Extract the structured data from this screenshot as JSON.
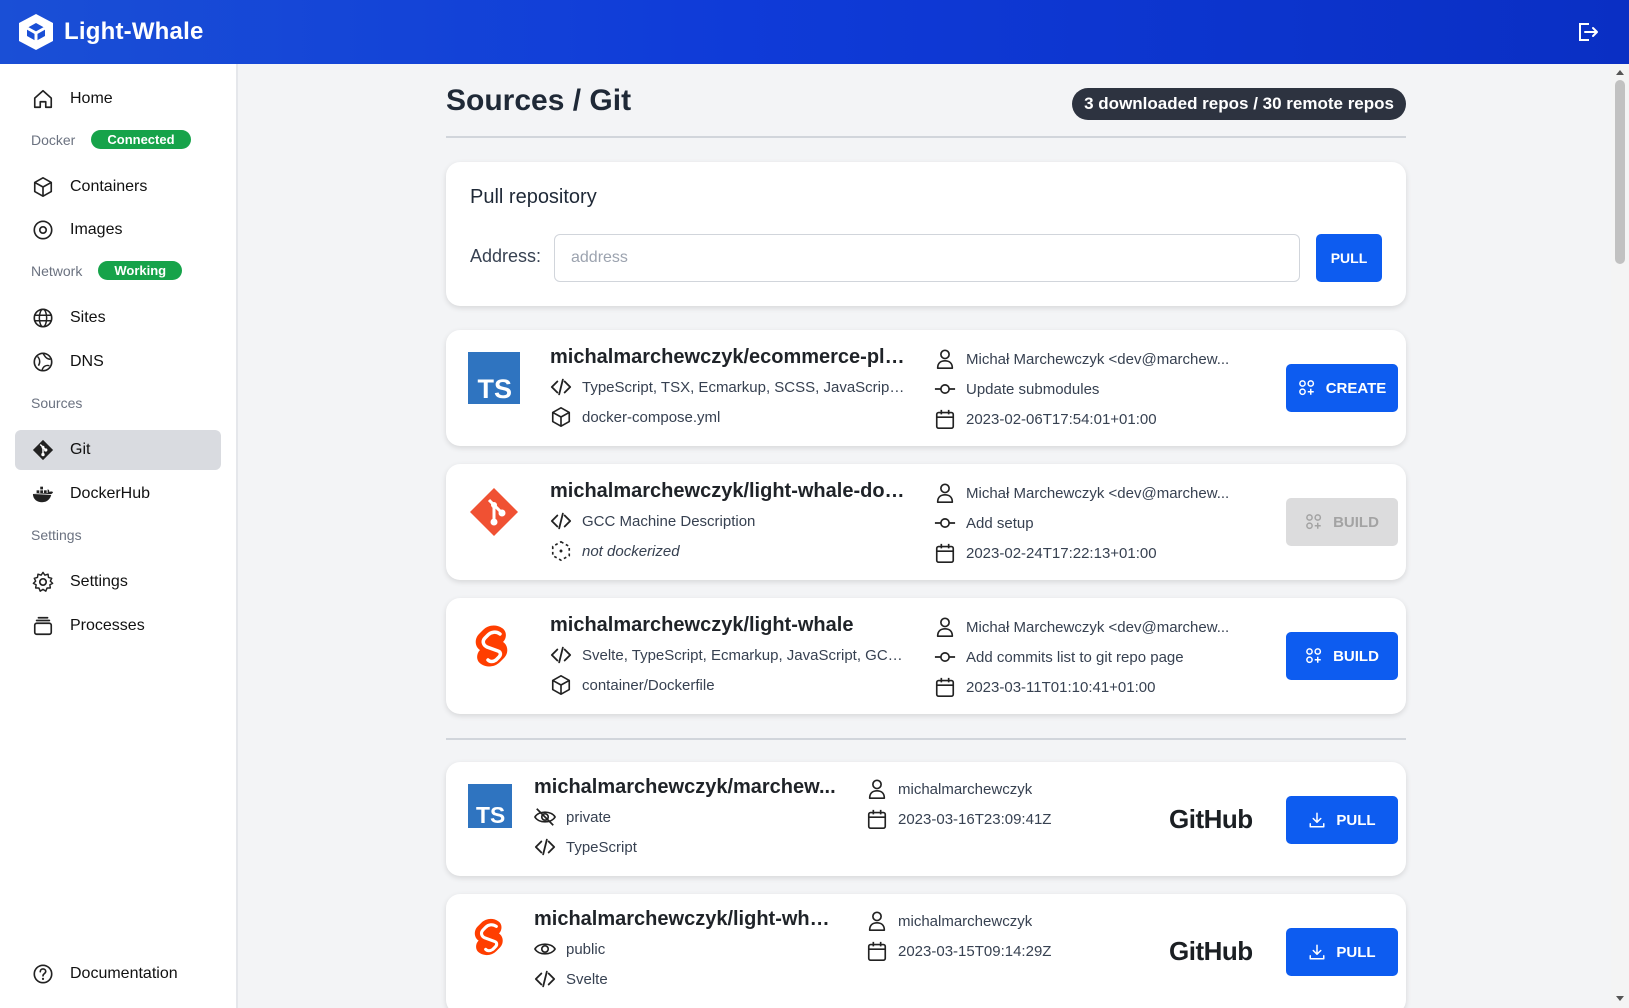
{
  "app": {
    "name": "Light-Whale"
  },
  "sidebar": {
    "home": "Home",
    "docker_label": "Docker",
    "docker_status": "Connected",
    "containers": "Containers",
    "images": "Images",
    "network_label": "Network",
    "network_status": "Working",
    "sites": "Sites",
    "dns": "DNS",
    "sources_label": "Sources",
    "git": "Git",
    "dockerhub": "DockerHub",
    "settings_label": "Settings",
    "settings": "Settings",
    "processes": "Processes",
    "documentation": "Documentation"
  },
  "page": {
    "title": "Sources / Git",
    "counter": "3 downloaded repos / 30 remote repos"
  },
  "pull": {
    "title": "Pull repository",
    "address_label": "Address:",
    "address_placeholder": "address",
    "address_value": "",
    "button": "PULL"
  },
  "local_repos": [
    {
      "language_icon": "typescript-logo",
      "name": "michalmarchewczyk/ecommerce-pla...",
      "languages": "TypeScript, TSX, Ecmarkup, SCSS, JavaScript, ...",
      "docker_file": "docker-compose.yml",
      "author": "Michał Marchewczyk <dev@marchew...",
      "commit": "Update submodules",
      "date": "2023-02-06T17:54:01+01:00",
      "action": "CREATE"
    },
    {
      "language_icon": "git-logo",
      "name": "michalmarchewczyk/light-whale-docs",
      "languages": "GCC Machine Description",
      "docker_file": "not dockerized",
      "author": "Michał Marchewczyk <dev@marchew...",
      "commit": "Add setup",
      "date": "2023-02-24T17:22:13+01:00",
      "action": "BUILD"
    },
    {
      "language_icon": "svelte-logo",
      "name": "michalmarchewczyk/light-whale",
      "languages": "Svelte, TypeScript, Ecmarkup, JavaScript, GCC...",
      "docker_file": "container/Dockerfile",
      "author": "Michał Marchewczyk <dev@marchew...",
      "commit": "Add commits list to git repo page",
      "date": "2023-03-11T01:10:41+01:00",
      "action": "BUILD"
    }
  ],
  "remote_repos": [
    {
      "language_icon": "typescript-logo",
      "name": "michalmarchewczyk/marchew...",
      "visibility": "private",
      "language": "TypeScript",
      "owner": "michalmarchewczyk",
      "date": "2023-03-16T23:09:41Z",
      "provider": "GitHub",
      "action": "PULL"
    },
    {
      "language_icon": "svelte-logo",
      "name": "michalmarchewczyk/light-whale",
      "visibility": "public",
      "language": "Svelte",
      "owner": "michalmarchewczyk",
      "date": "2023-03-15T09:14:29Z",
      "provider": "GitHub",
      "action": "PULL"
    }
  ],
  "colors": {
    "primary": "#0d5cf0",
    "success": "#16a34a",
    "typescript": "#2f74c0",
    "git": "#f05133",
    "svelte": "#ff3e00"
  }
}
